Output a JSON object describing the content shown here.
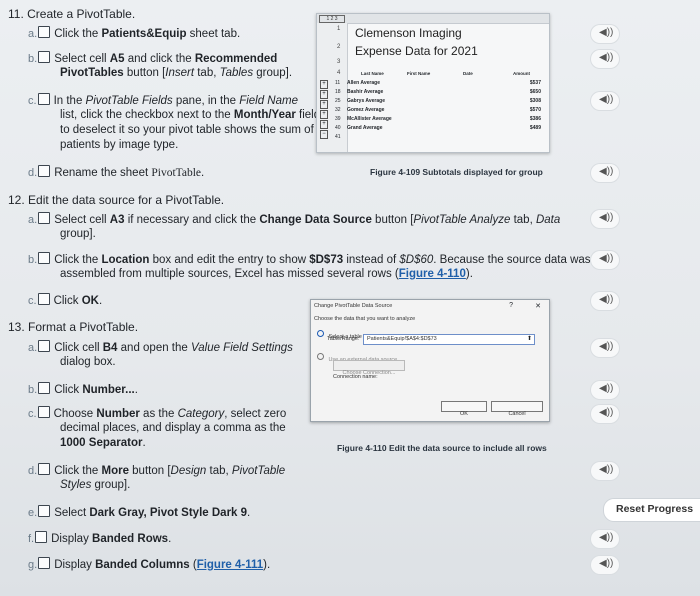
{
  "s11": {
    "title": "11. Create a PivotTable.",
    "a": {
      "letter": "a.",
      "t1": "Click the ",
      "b1": "Patients&Equip",
      "t2": " sheet tab."
    },
    "b": {
      "letter": "b.",
      "l1a": "Select cell ",
      "l1b": "A5",
      "l1c": " and click the ",
      "l1d": "Recommended",
      "l2a": "PivotTables",
      "l2b": " button [",
      "l2c": "Insert",
      "l2d": " tab, ",
      "l2e": "Tables",
      "l2f": " group]."
    },
    "c": {
      "letter": "c.",
      "l1a": "In the ",
      "l1b": "PivotTable Fields",
      "l1c": " pane, in the ",
      "l1d": "Field Name",
      "l2a": "list, click the checkbox next to the ",
      "l2b": "Month/Year",
      "l2c": " field",
      "l3": "to deselect it so your pivot table shows the sum of",
      "l4": "patients by image type."
    },
    "d": {
      "letter": "d.",
      "t1": "Rename the sheet ",
      "t2": "PivotTable",
      "t3": "."
    }
  },
  "fig109": {
    "title1": "Clemenson Imaging",
    "title2": "Expense Data for 2021",
    "col_headers": [
      "Last Name",
      "First Name",
      "Date",
      "Amount"
    ],
    "rows": [
      {
        "num": "11",
        "label": "Allen Average",
        "amt": "$537"
      },
      {
        "num": "18",
        "label": "Bashir Average",
        "amt": "$650"
      },
      {
        "num": "25",
        "label": "Gabrys Average",
        "amt": "$308"
      },
      {
        "num": "32",
        "label": "Gomez Average",
        "amt": "$570"
      },
      {
        "num": "39",
        "label": "McAllister Average",
        "amt": "$386"
      },
      {
        "num": "40",
        "label": "Grand Average",
        "amt": "$489"
      },
      {
        "num": "41",
        "label": "",
        "amt": ""
      }
    ],
    "top_rows": [
      "1",
      "2",
      "3",
      "4"
    ],
    "caption": "Figure 4-109 Subtotals displayed for group"
  },
  "s12": {
    "title": "12. Edit the data source for a PivotTable.",
    "a": {
      "letter": "a.",
      "l1a": "Select cell ",
      "l1b": "A3",
      "l1c": " if necessary and click the ",
      "l1d": "Change Data Source",
      "l1e": " button [",
      "l1f": "PivotTable Analyze",
      "l1g": " tab, ",
      "l1h": "Data",
      "l2": "group]."
    },
    "b": {
      "letter": "b.",
      "l1a": "Click the ",
      "l1b": "Location",
      "l1c": " box and edit the entry to show ",
      "l1d": "$D$73",
      "l1e": " instead of ",
      "l1f": "$D$60",
      "l1g": ". Because the source data was",
      "l2a": "assembled from multiple sources, Excel has missed several rows (",
      "l2b": "Figure 4-110",
      "l2c": ")."
    },
    "c": {
      "letter": "c.",
      "t1": "Click ",
      "t2": "OK",
      "t3": "."
    }
  },
  "dialog": {
    "title": "Change PivotTable Data Source",
    "help": "?",
    "close": "✕",
    "choose": "Choose the data that you want to analyze",
    "opt1": "Select a table or range",
    "table_label": "Table/Range:",
    "range_value": "Patients&Equip!$A$4:$D$73",
    "opt2": "Use an external data source",
    "choose_conn": "Choose Connection...",
    "conn_name": "Connection name:",
    "ok": "OK",
    "cancel": "Cancel",
    "caption": "Figure 4-110 Edit the data source to include all rows"
  },
  "s13": {
    "title": "13. Format a PivotTable.",
    "a": {
      "letter": "a.",
      "l1a": "Click cell ",
      "l1b": "B4",
      "l1c": " and open the ",
      "l1d": "Value Field Settings",
      "l2": "dialog box."
    },
    "b": {
      "letter": "b.",
      "t1": "Click ",
      "t2": "Number...",
      "t3": "."
    },
    "c": {
      "letter": "c.",
      "l1a": "Choose ",
      "l1b": "Number",
      "l1c": " as the ",
      "l1d": "Category",
      "l1e": ", select zero",
      "l2": "decimal places, and display a comma as the",
      "l3": "1000 Separator",
      "l3b": "."
    },
    "d": {
      "letter": "d.",
      "l1a": "Click the ",
      "l1b": "More",
      "l1c": " button [",
      "l1d": "Design",
      "l1e": " tab, ",
      "l1f": "PivotTable",
      "l2": "Styles",
      "l2b": " group]."
    },
    "e": {
      "letter": "e.",
      "t1": "Select ",
      "t2": "Dark Gray, Pivot Style Dark 9",
      "t3": "."
    },
    "f": {
      "letter": "f.",
      "t1": "Display ",
      "t2": "Banded Rows",
      "t3": "."
    },
    "g": {
      "letter": "g.",
      "t1": "Display ",
      "t2": "Banded Columns",
      "t3": " (",
      "t4": "Figure 4-111",
      "t5": ")."
    }
  },
  "reset_label": "Reset Progress",
  "audio_icon": "speaker-icon"
}
